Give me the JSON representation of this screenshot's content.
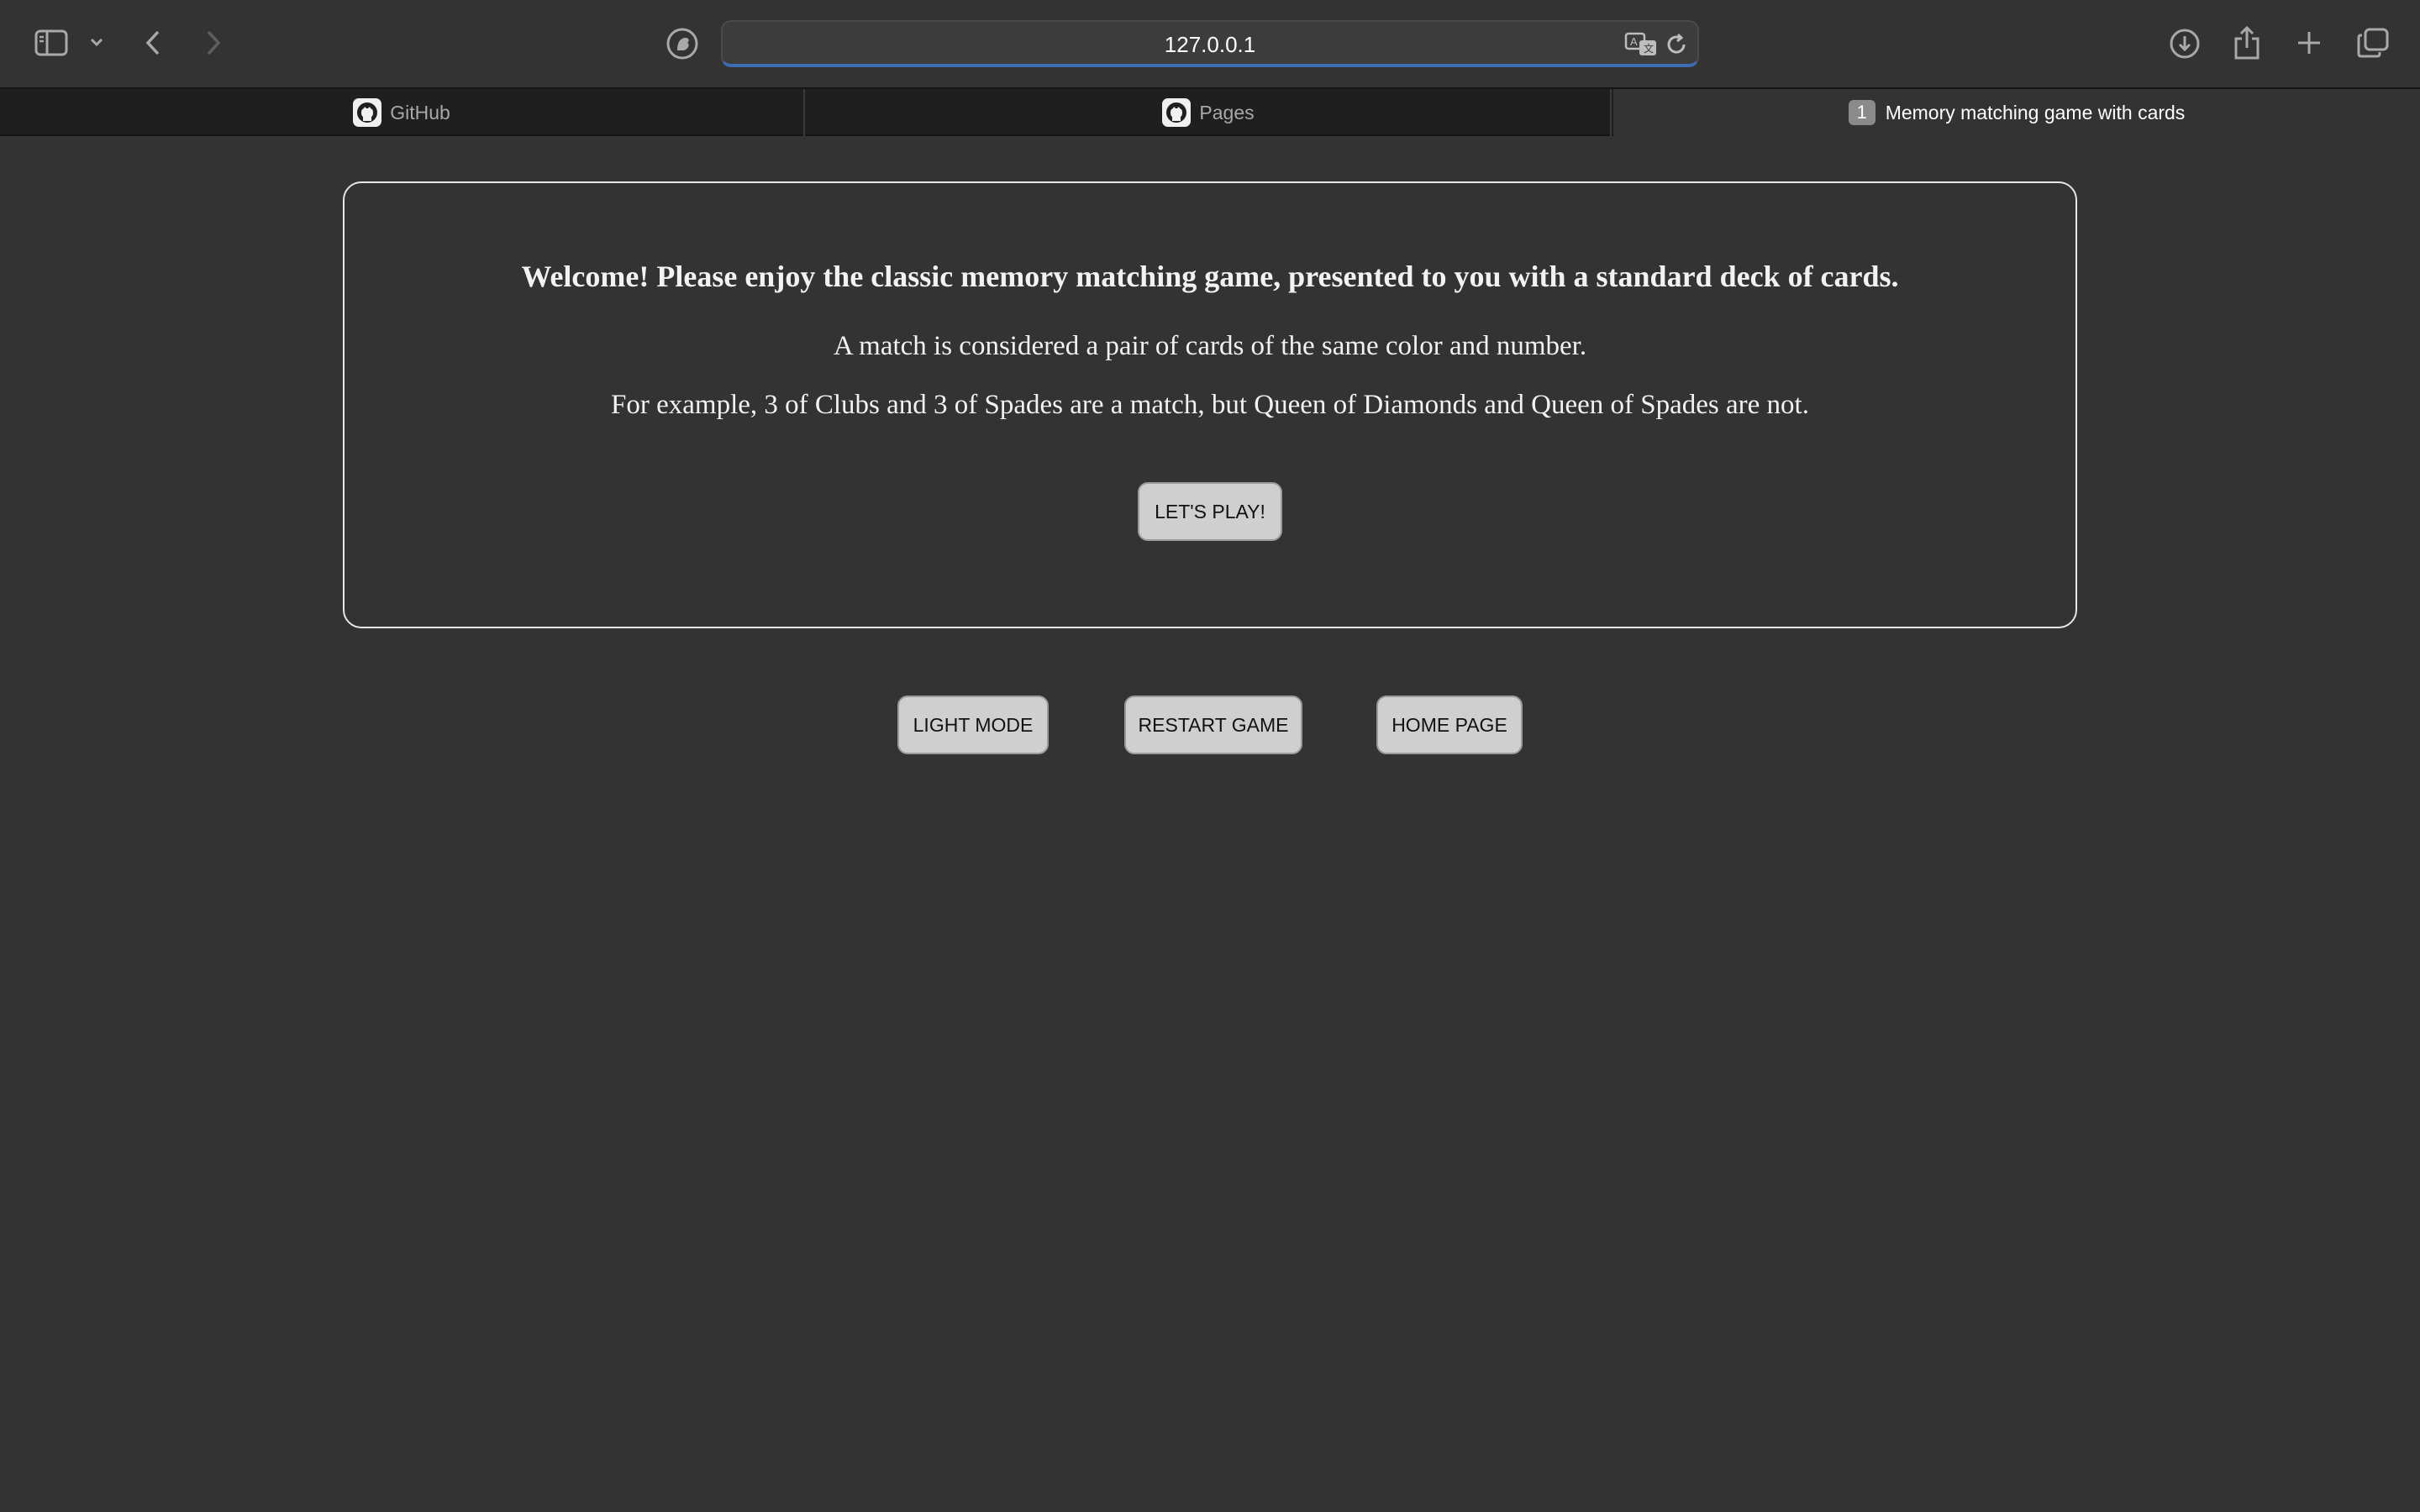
{
  "browser": {
    "url": "127.0.0.1",
    "icons": {
      "sidebar": "sidebar-icon",
      "tab_group_menu": "chevron-down-icon",
      "back": "chevron-left-icon",
      "forward": "chevron-right-icon",
      "privacy": "duck-shield-icon",
      "translate": "translate-icon",
      "reload": "reload-icon",
      "downloads": "download-icon",
      "share": "share-icon",
      "new_tab": "plus-icon",
      "tab_overview": "tabs-overview-icon"
    },
    "accent_color": "#3d6fb3"
  },
  "tabs": [
    {
      "label": "GitHub",
      "icon": "github-icon",
      "active": false
    },
    {
      "label": "Pages",
      "icon": "github-icon",
      "active": false
    },
    {
      "label": "Memory matching game with cards",
      "badge": "1",
      "active": true
    }
  ],
  "page": {
    "welcome_title": "Welcome! Please enjoy the classic memory matching game, presented to you with a standard deck of cards.",
    "rule_line_1": "A match is considered a pair of cards of the same color and number.",
    "rule_line_2": "For example, 3 of Clubs and 3 of Spades are a match, but Queen of Diamonds and Queen of Spades are not.",
    "play_button": "LET'S PLAY!",
    "controls": {
      "light_mode": "LIGHT MODE",
      "restart": "RESTART GAME",
      "home": "HOME PAGE"
    },
    "background_color": "#333333",
    "button_color": "#cfcfcf"
  }
}
